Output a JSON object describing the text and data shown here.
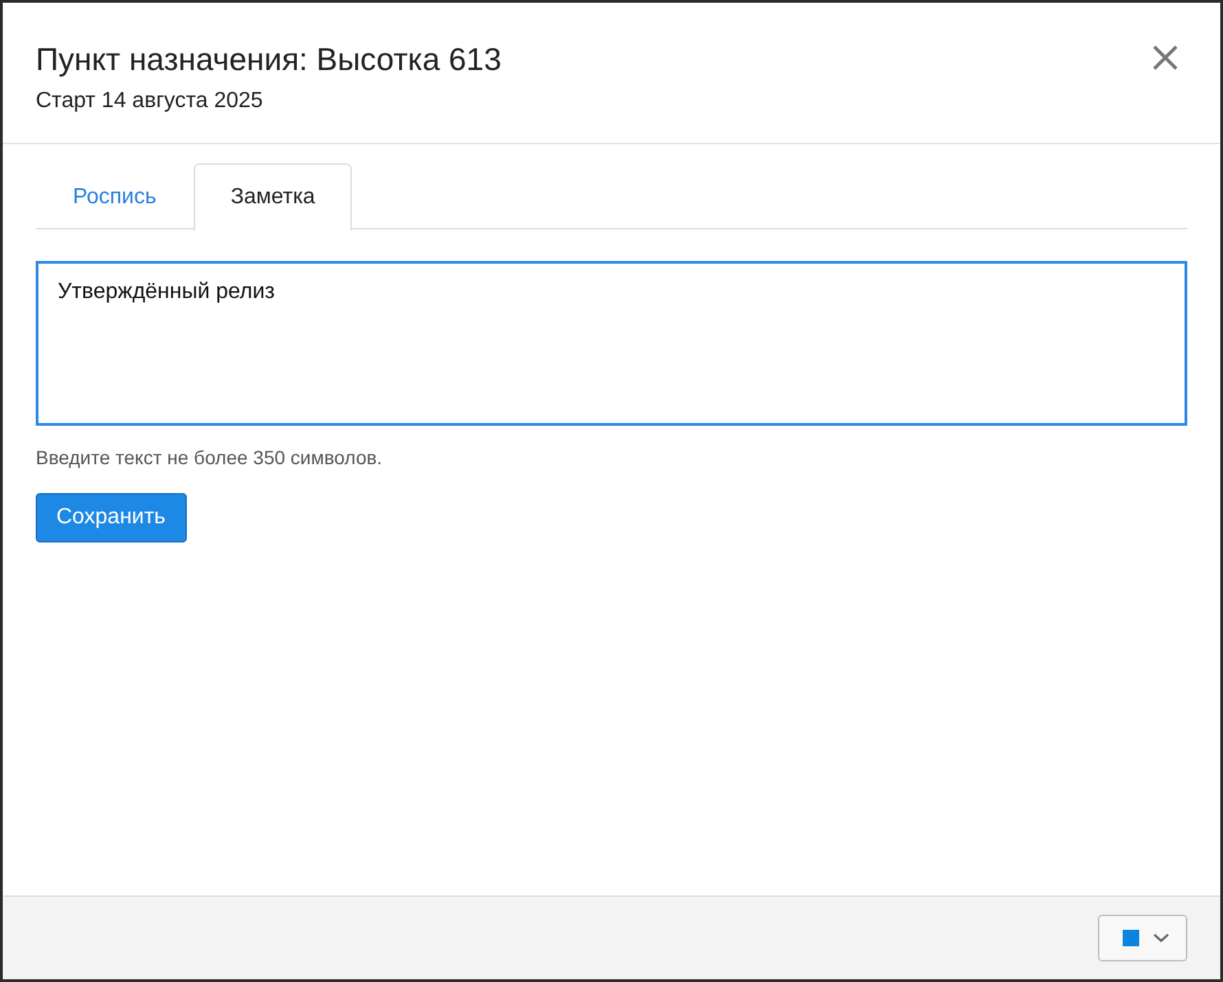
{
  "dialog": {
    "title": "Пункт назначения: Высотка 613",
    "subtitle": "Старт 14 августа 2025"
  },
  "tabs": [
    {
      "label": "Роспись",
      "selected": false
    },
    {
      "label": "Заметка",
      "selected": true
    }
  ],
  "note": {
    "value": "Утверждённый релиз",
    "focused": true,
    "hint": "Введите текст не более 350 символов."
  },
  "buttons": [
    "Сохранить"
  ],
  "footer": {
    "color_picker": {
      "color": "#0a84e0"
    }
  }
}
